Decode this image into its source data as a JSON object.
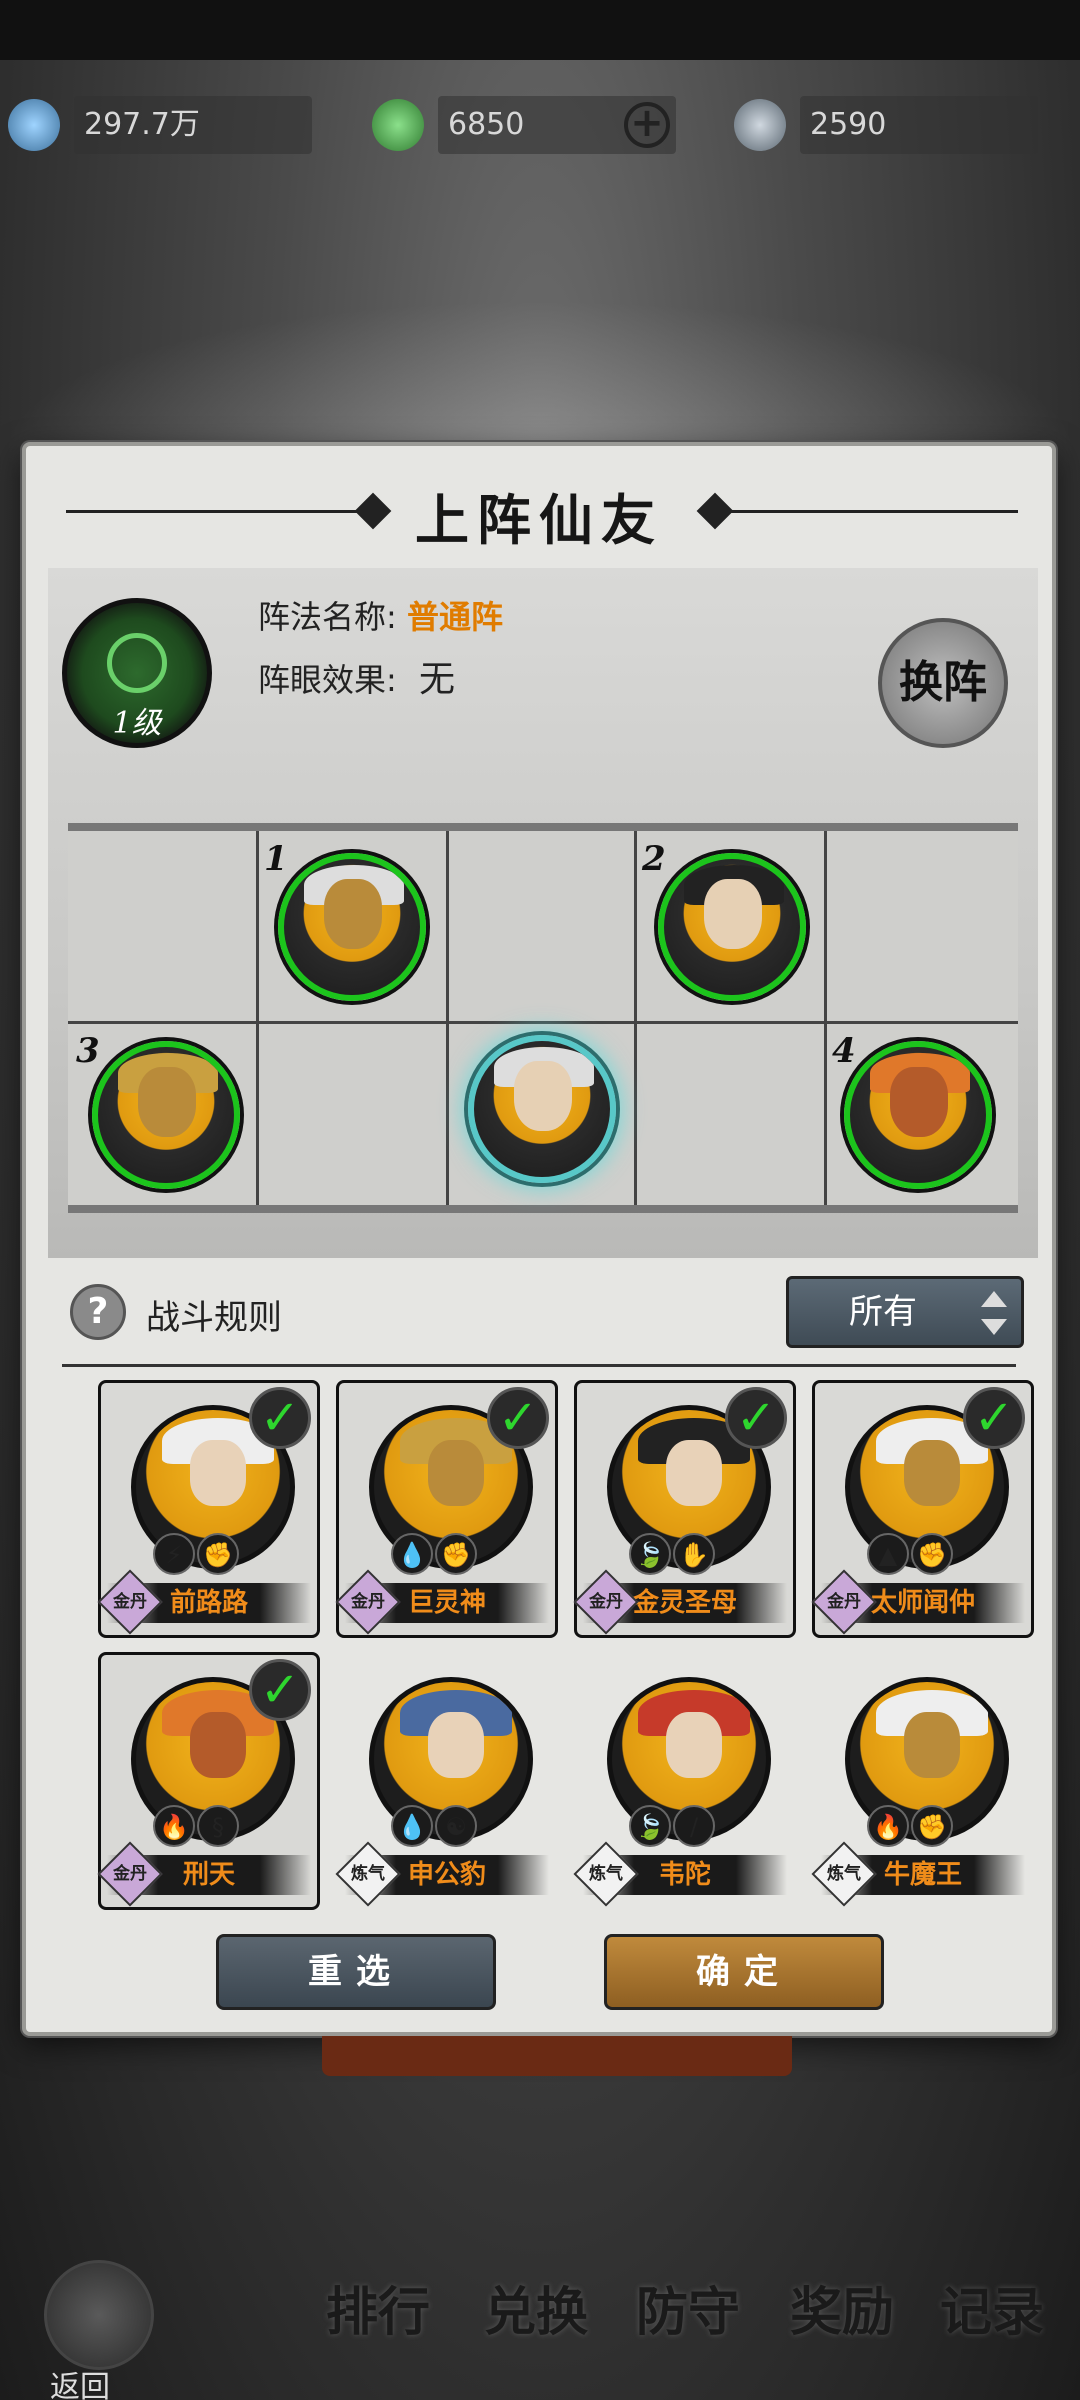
{
  "resources": [
    {
      "icon": "crystal-icon",
      "value": "297.7万"
    },
    {
      "icon": "spirit-icon",
      "value": "6850"
    },
    {
      "icon": "orb-icon",
      "value": "2590"
    }
  ],
  "modal": {
    "title": "上阵仙友",
    "formation": {
      "level": "1级",
      "name_label": "阵法名称:",
      "name_value": "普通阵",
      "eye_label": "阵眼效果:",
      "eye_value": "无",
      "swap_label": "换阵",
      "slot_numbers": [
        "1",
        "2",
        "3",
        "4"
      ]
    },
    "rules_label": "战斗规则",
    "filter_value": "所有",
    "roster": [
      {
        "name": "前路路",
        "tag": "金丹",
        "selected": true,
        "elements": [
          "⚡",
          "✊"
        ]
      },
      {
        "name": "巨灵神",
        "tag": "金丹",
        "selected": true,
        "elements": [
          "💧",
          "✊"
        ]
      },
      {
        "name": "金灵圣母",
        "tag": "金丹",
        "selected": true,
        "elements": [
          "🍃",
          "✋"
        ]
      },
      {
        "name": "太师闻仲",
        "tag": "金丹",
        "selected": true,
        "elements": [
          "▲",
          "✊"
        ]
      },
      {
        "name": "刑天",
        "tag": "金丹",
        "selected": true,
        "elements": [
          "🔥",
          "§"
        ]
      },
      {
        "name": "申公豹",
        "tag": "炼气",
        "selected": false,
        "elements": [
          "💧",
          "☯"
        ]
      },
      {
        "name": "韦陀",
        "tag": "炼气",
        "selected": false,
        "elements": [
          "🍃",
          "/"
        ]
      },
      {
        "name": "牛魔王",
        "tag": "炼气",
        "selected": false,
        "elements": [
          "🔥",
          "✊"
        ]
      }
    ],
    "reset_label": "重选",
    "confirm_label": "确定"
  },
  "bottom_nav": {
    "back_label": "返回",
    "items": [
      "排行",
      "兑换",
      "防守",
      "奖励",
      "记录"
    ]
  }
}
